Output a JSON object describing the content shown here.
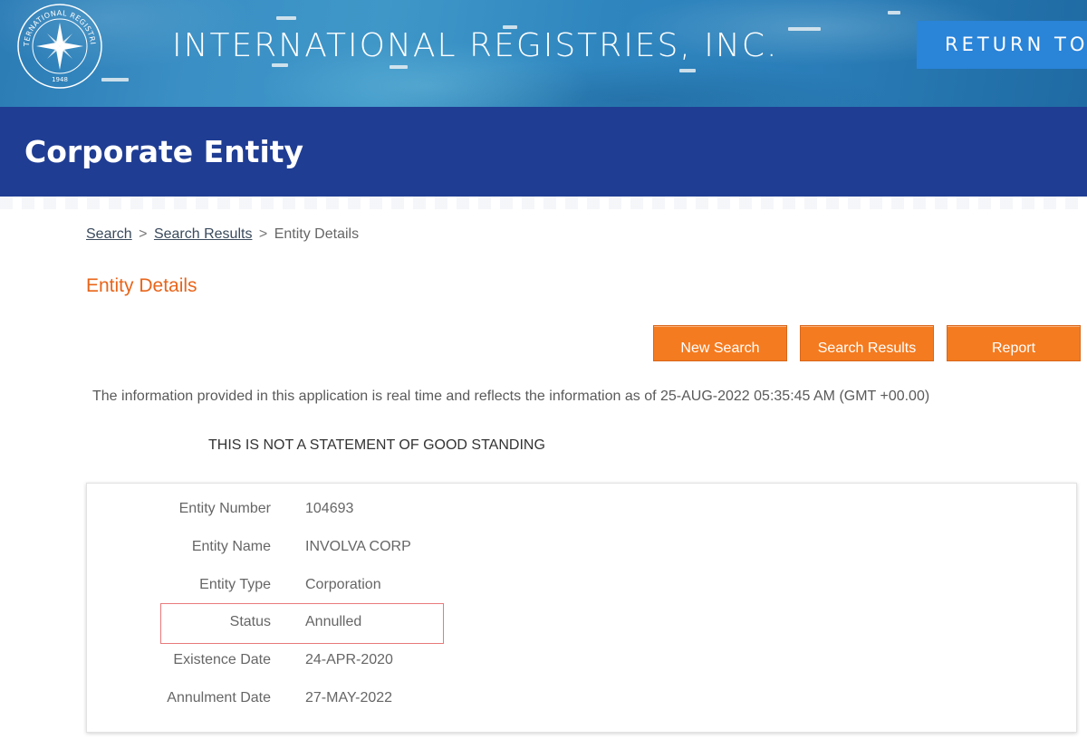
{
  "header": {
    "logo_text": "INTERNATIONAL REGISTRIES",
    "logo_year": "1948",
    "brand": "INTERNATIONAL REGISTRIES, INC.",
    "return_label": "RETURN TO"
  },
  "page": {
    "title": "Corporate Entity"
  },
  "breadcrumb": {
    "search": "Search",
    "results": "Search Results",
    "current": "Entity Details",
    "separator": ">"
  },
  "section_title": "Entity Details",
  "actions": {
    "new_search": "New Search",
    "search_results": "Search Results",
    "report": "Report"
  },
  "info_text": "The information provided in this application is real time and reflects the information as of 25-AUG-2022 05:35:45 AM (GMT +00.00)",
  "notice": "THIS IS NOT A STATEMENT OF GOOD STANDING",
  "details": [
    {
      "label": "Entity Number",
      "value": "104693"
    },
    {
      "label": "Entity Name",
      "value": "INVOLVA CORP"
    },
    {
      "label": "Entity Type",
      "value": "Corporation"
    },
    {
      "label": "Status",
      "value": "Annulled"
    },
    {
      "label": "Existence Date",
      "value": "24-APR-2020"
    },
    {
      "label": "Annulment Date",
      "value": "27-MAY-2022"
    }
  ],
  "colors": {
    "title_bar": "#1f3d93",
    "accent_orange": "#f47b20",
    "return_button": "#2a84d8",
    "highlight_border": "#e9797a"
  }
}
